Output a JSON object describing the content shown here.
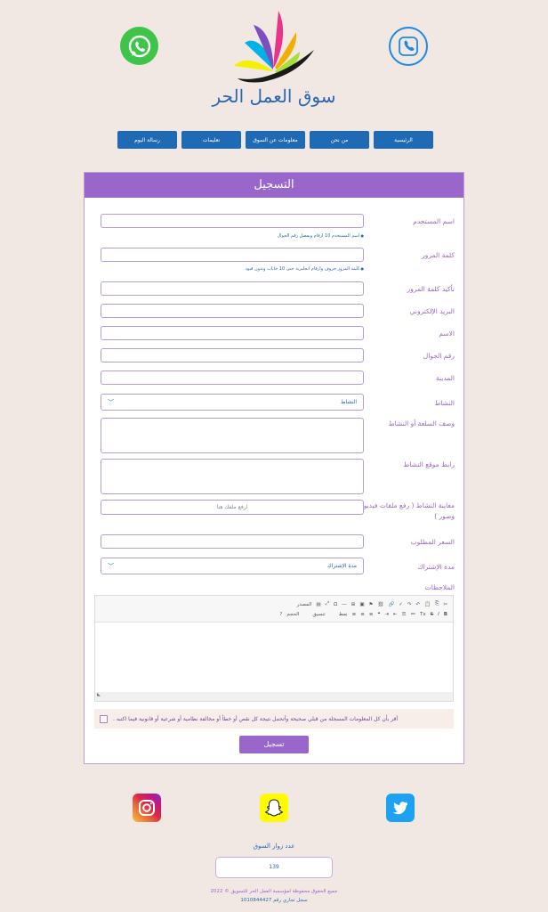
{
  "header": {
    "site_title": "سوق العمل الحر",
    "whatsapp_icon": "whatsapp-icon",
    "phone_icon": "phone-icon",
    "logo": "lotus-logo"
  },
  "nav": {
    "items": [
      "الرئيسية",
      "من نحن",
      "معلومات عن السوق",
      "تعليمات",
      "رسالة اليوم"
    ]
  },
  "form": {
    "title": "التسجيل",
    "username_label": "اسم المستخدم",
    "username_hint": "اسم المستخدم 10 ارقام ويفضل رقم الجوال",
    "password_label": "كلمة المرور",
    "password_hint": "كلمة المرور حروف وارقام انجليزية حتى 10 خانات وبدون قيود",
    "confirm_label": "تأكيد كلمة المرور",
    "email_label": "البريد الإلكتروني",
    "name_label": "الاسم",
    "mobile_label": "رقم الجوال",
    "city_label": "المدينة",
    "activity_label": "النشاط",
    "activity_selected": "النشاط",
    "description_label": "وصف السلعة أو النشاط",
    "link_label": "رابط موقع النشاط",
    "preview_label": "معاينة النشاط ( رفع ملفات فيديو وصور )",
    "upload_placeholder": "ارفع ملفك هنا",
    "price_label": "السعر المطلوب",
    "subscription_label": "مدة الإشتراك",
    "subscription_selected": "مدة الإشتراك",
    "notes_label": "الملاحظات",
    "editor_source": "المصدر",
    "editor_format": "تنسيق",
    "editor_size": "الحجم",
    "editor_font": "نمط",
    "agree_text": "أقر بأن كل المعلومات المسجلة من قبلي صحيحة وأتحمل نتيجة كل نقص أو خطأ أو مخالفة نظامية أو شرعية أو قانونية فيما اكتبه .",
    "submit_label": "تسجيل"
  },
  "social": [
    "instagram-icon",
    "snapchat-icon",
    "twitter-icon"
  ],
  "footer": {
    "visitors_label": "عدد زوار السوق",
    "visitors_count": "139",
    "copyright": "جميع الحقوق محفوظة لمؤسسة العمل الحر للتسويق © 2022",
    "register_no": "سجل تجاري رقم 1010844427"
  },
  "colors": {
    "accent": "#9966cc",
    "nav_blue": "#1e6ab4",
    "background": "#f2e8e3"
  }
}
